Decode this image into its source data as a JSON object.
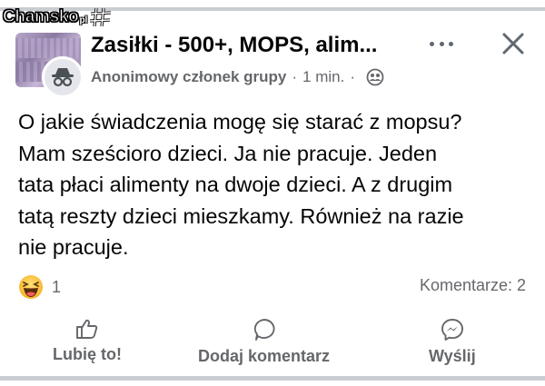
{
  "watermark": {
    "text": "Chamsko",
    "suffix": "pl"
  },
  "post": {
    "group_title": "Zasiłki - 500+, MOPS, alim...",
    "author": "Anonimowy członek grupy",
    "separator": "·",
    "time": "1 min.",
    "time_separator": "·",
    "text_lines": [
      "O jakie świadczenia mogę się starać z mopsu?",
      "Mam sześcioro dzieci. Ja nie pracuje. Jeden",
      "tata płaci alimenty na dwoje dzieci. A z drugim",
      "tatą reszty dzieci mieszkamy. Również na razie",
      "nie pracuje."
    ]
  },
  "stats": {
    "reaction_count": "1",
    "comments": "Komentarze: 2"
  },
  "actions": {
    "like": "Lubię to!",
    "comment": "Dodaj komentarz",
    "send": "Wyślij"
  },
  "icons": {
    "reaction": "haha-emoji-icon",
    "more": "more-dots-icon",
    "close": "close-icon",
    "privacy": "group-members-icon",
    "like": "thumbs-up-icon",
    "comment": "comment-bubble-icon",
    "send": "messenger-icon"
  },
  "colors": {
    "text": "#050505",
    "secondary": "#65676b",
    "frame": "#c9ccd1",
    "reaction": "#f7b125"
  }
}
